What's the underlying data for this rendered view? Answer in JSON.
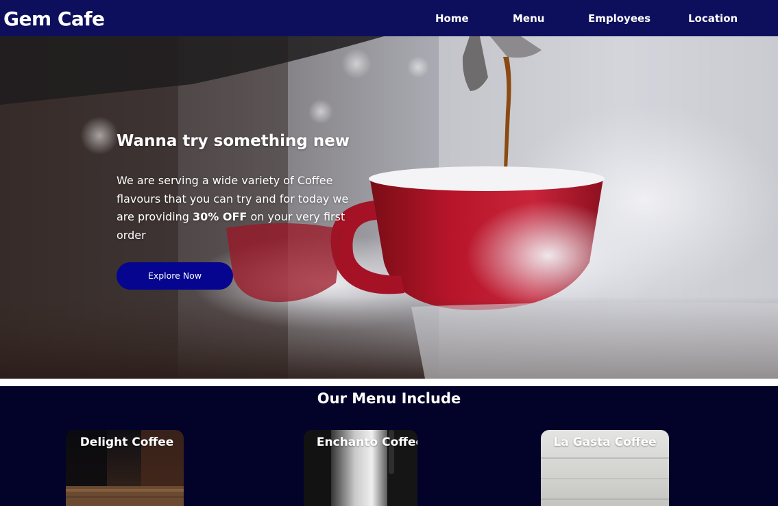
{
  "navbar": {
    "brand": "Gem Cafe",
    "links": [
      "Home",
      "Menu",
      "Employees",
      "Location"
    ]
  },
  "hero": {
    "title": "Wanna try something new",
    "text_before": "We are serving a wide variety of Coffee flavours that you can try and for today we are providing ",
    "text_highlight": "30% OFF",
    "text_after": " on your very first order",
    "button_label": "Explore Now"
  },
  "menu": {
    "heading": "Our Menu Include",
    "items": [
      {
        "title": "Delight Coffee"
      },
      {
        "title": "Enchanto Coffee"
      },
      {
        "title": "La Gasta Coffee"
      }
    ]
  },
  "colors": {
    "navbar_bg": "#0e0f5c",
    "button_bg": "#05058f",
    "menu_bg": "#03032a"
  }
}
